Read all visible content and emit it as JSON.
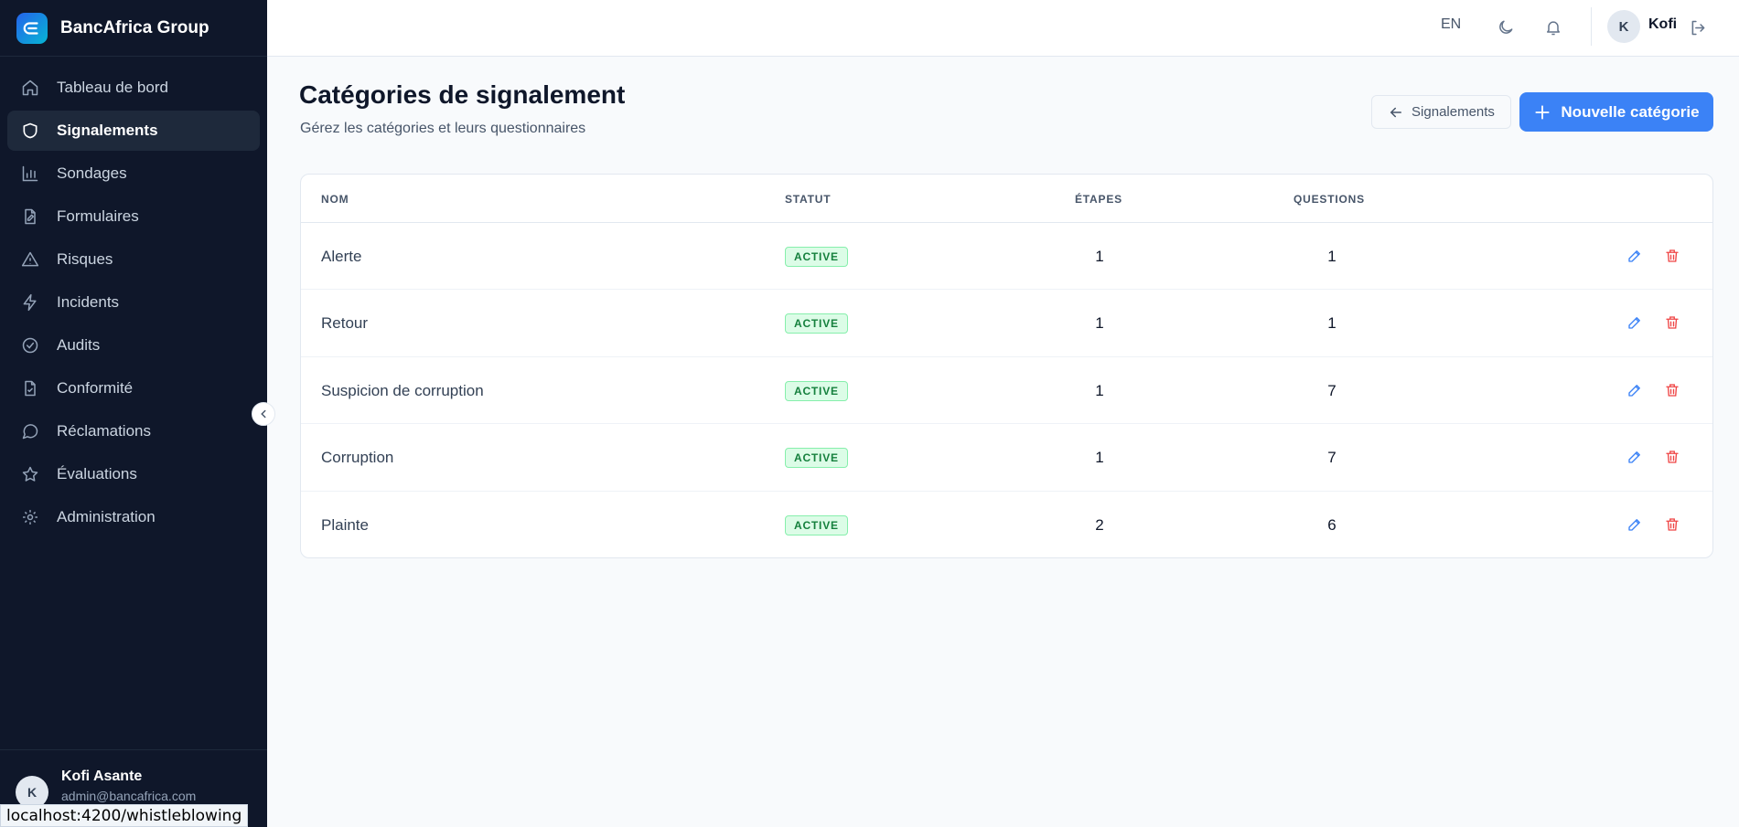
{
  "brand": {
    "name": "BancAfrica Group"
  },
  "sidebar": {
    "items": [
      {
        "label": "Tableau de bord",
        "icon": "home-icon"
      },
      {
        "label": "Signalements",
        "icon": "shield-icon",
        "active": true
      },
      {
        "label": "Sondages",
        "icon": "bar-chart-icon"
      },
      {
        "label": "Formulaires",
        "icon": "file-edit-icon"
      },
      {
        "label": "Risques",
        "icon": "alert-triangle-icon"
      },
      {
        "label": "Incidents",
        "icon": "zap-icon"
      },
      {
        "label": "Audits",
        "icon": "check-circle-icon"
      },
      {
        "label": "Conformité",
        "icon": "file-check-icon"
      },
      {
        "label": "Réclamations",
        "icon": "message-icon"
      },
      {
        "label": "Évaluations",
        "icon": "star-icon"
      },
      {
        "label": "Administration",
        "icon": "gear-icon"
      }
    ],
    "user": {
      "initial": "K",
      "name": "Kofi Asante",
      "email": "admin@bancafrica.com"
    }
  },
  "status_url": "localhost:4200/whistleblowing",
  "header": {
    "lang": "EN",
    "user_initial": "K",
    "user_name": "Kofi"
  },
  "page": {
    "title": "Catégories de signalement",
    "subtitle": "Gérez les catégories et leurs questionnaires",
    "back_label": "Signalements",
    "new_label": "Nouvelle catégorie"
  },
  "table": {
    "headers": {
      "name": "NOM",
      "status": "STATUT",
      "steps": "ÉTAPES",
      "questions": "QUESTIONS"
    },
    "rows": [
      {
        "name": "Alerte",
        "status": "ACTIVE",
        "steps": "1",
        "questions": "1"
      },
      {
        "name": "Retour",
        "status": "ACTIVE",
        "steps": "1",
        "questions": "1"
      },
      {
        "name": "Suspicion de corruption",
        "status": "ACTIVE",
        "steps": "1",
        "questions": "7"
      },
      {
        "name": "Corruption",
        "status": "ACTIVE",
        "steps": "1",
        "questions": "7"
      },
      {
        "name": "Plainte",
        "status": "ACTIVE",
        "steps": "2",
        "questions": "6"
      }
    ]
  },
  "colors": {
    "sidebar_bg": "#0f172a",
    "accent": "#3b82f6",
    "danger": "#ef4444",
    "success": "#15803d"
  }
}
